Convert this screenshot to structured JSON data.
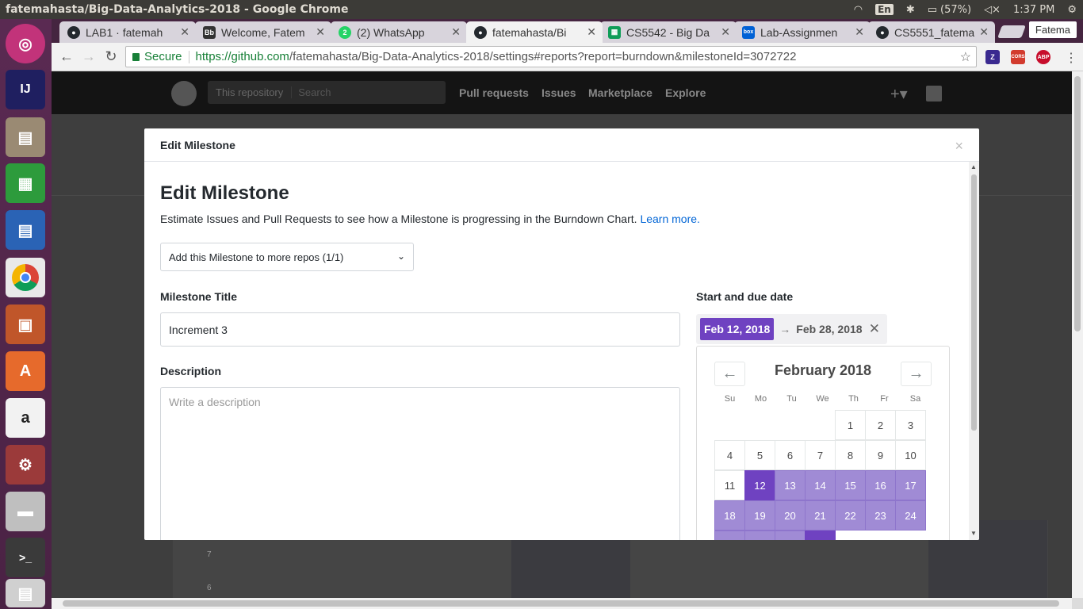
{
  "os": {
    "window_title": "fatemahasta/Big-Data-Analytics-2018 - Google Chrome",
    "language": "En",
    "battery": "(57%)",
    "clock": "1:37 PM"
  },
  "tabs": [
    {
      "label": "LAB1 · fatemah",
      "icon": "github-icon",
      "color": "#24292e"
    },
    {
      "label": "Welcome, Fatem",
      "icon": "blackboard-icon",
      "color": "#333333",
      "glyph": "Bb"
    },
    {
      "label": "(2) WhatsApp",
      "icon": "whatsapp-icon",
      "color": "#25d366",
      "glyph": "2"
    },
    {
      "label": "fatemahasta/Bi",
      "icon": "github-icon",
      "color": "#24292e"
    },
    {
      "label": "CS5542 - Big Da",
      "icon": "sheets-icon",
      "color": "#0f9d58"
    },
    {
      "label": "Lab-Assignmen",
      "icon": "box-icon",
      "color": "#0061d5",
      "glyph": "box"
    },
    {
      "label": "CS5551_fatema",
      "icon": "github-icon",
      "color": "#24292e"
    }
  ],
  "profile_name": "Fatema",
  "address": {
    "secure_label": "Secure",
    "scheme_host": "https://github.com",
    "path": "/fatemahasta/Big-Data-Analytics-2018/settings#reports?report=burndown&milestoneId=3072722"
  },
  "github": {
    "scope": "This repository",
    "search_placeholder": "Search",
    "nav": [
      "Pull requests",
      "Issues",
      "Marketplace",
      "Explore"
    ]
  },
  "chart_ticks": [
    "7",
    "6"
  ],
  "modal": {
    "header_title": "Edit Milestone",
    "heading": "Edit Milestone",
    "intro": "Estimate Issues and Pull Requests to see how a Milestone is progressing in the Burndown Chart.",
    "learn_more": "Learn more.",
    "repo_select": "Add this Milestone to more repos (1/1)",
    "title_label": "Milestone Title",
    "title_value": "Increment 3",
    "description_label": "Description",
    "description_placeholder": "Write a description",
    "dates_label": "Start and due date",
    "start_date": "Feb 12, 2018",
    "arrow": "→",
    "due_date": "Feb 28, 2018"
  },
  "calendar": {
    "month": "February 2018",
    "weekdays": [
      "Su",
      "Mo",
      "Tu",
      "We",
      "Th",
      "Fr",
      "Sa"
    ],
    "weeks": [
      [
        "",
        "",
        "",
        "",
        "1",
        "2",
        "3"
      ],
      [
        "4",
        "5",
        "6",
        "7",
        "8",
        "9",
        "10"
      ],
      [
        "11",
        "12",
        "13",
        "14",
        "15",
        "16",
        "17"
      ],
      [
        "18",
        "19",
        "20",
        "21",
        "22",
        "23",
        "24"
      ]
    ],
    "start_day": "12",
    "range_end_day": "28",
    "range_color": "#a08bd5",
    "start_color": "#6f42c1"
  }
}
